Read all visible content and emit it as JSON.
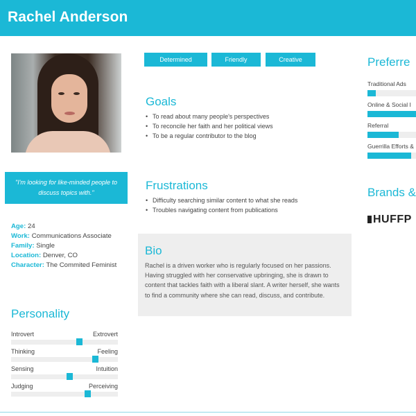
{
  "header": {
    "name": "Rachel Anderson"
  },
  "quote": "\"I'm looking for like-minded people to discuss topics with.\"",
  "facts": [
    {
      "key": "Age:",
      "value": "24"
    },
    {
      "key": "Work:",
      "value": "Communications Associate"
    },
    {
      "key": "Family:",
      "value": "Single"
    },
    {
      "key": "Location:",
      "value": "Denver, CO"
    },
    {
      "key": "Character:",
      "value": "The Commited Feminist"
    }
  ],
  "personality": {
    "title": "Personality",
    "rows": [
      {
        "left": "Introvert",
        "right": "Extrovert",
        "level": 0.64
      },
      {
        "left": "Thinking",
        "right": "Feeling",
        "level": 0.79
      },
      {
        "left": "Sensing",
        "right": "Intuition",
        "level": 0.55
      },
      {
        "left": "Judging",
        "right": "Perceiving",
        "level": 0.72
      }
    ]
  },
  "tags": [
    "Determined",
    "Friendly",
    "Creative"
  ],
  "goals": {
    "title": "Goals",
    "items": [
      "To read about many people's perspectives",
      "To reconcile her faith and her political views",
      "To be a regular contributor to the blog"
    ]
  },
  "frustrations": {
    "title": "Frustrations",
    "items": [
      "Difficulty searching similar content to what she reads",
      "Troubles navigating content from publications"
    ]
  },
  "bio": {
    "title": "Bio",
    "text": "Rachel is a driven worker who is regularly focused on her passions. Having struggled with her conservative upbringing, she is drawn to content that tackles faith with a liberal slant. A writer herself, she wants to find a community where she can read, discuss, and contribute."
  },
  "preferred": {
    "title": "Preferre",
    "channels": [
      {
        "label": "Traditional Ads",
        "level": 0.17
      },
      {
        "label": "Online & Social I",
        "level": 1.0
      },
      {
        "label": "Referral",
        "level": 0.64
      },
      {
        "label": "Guerrilla Efforts &",
        "level": 0.9
      }
    ]
  },
  "brands": {
    "title": "Brands &",
    "logo": "HUFFP"
  },
  "colors": {
    "accent": "#1bb8d6",
    "panel": "#eeeeee"
  }
}
